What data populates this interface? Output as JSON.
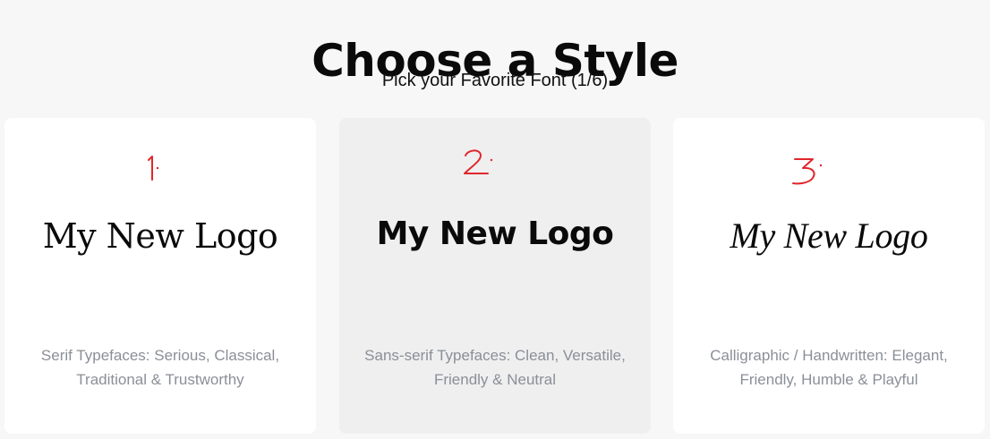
{
  "header": {
    "title": "Choose a Style",
    "subtitle": "Pick your Favorite Font (1/6)"
  },
  "cards": [
    {
      "number": "1.",
      "logo_text": "My New Logo",
      "description": "Serif Typefaces: Serious, Classical, Traditional & Trustworthy",
      "selected": false
    },
    {
      "number": "2.",
      "logo_text": "My New Logo",
      "description": "Sans-serif Typefaces: Clean, Versatile, Friendly & Neutral",
      "selected": true
    },
    {
      "number": "3.",
      "logo_text": "My New Logo",
      "description": "Calligraphic / Handwritten: Elegant, Friendly, Humble & Playful",
      "selected": false
    }
  ],
  "colors": {
    "background": "#f7f7f7",
    "card": "#ffffff",
    "card_highlight": "#efefef",
    "annotation": "#e0262b",
    "description_text": "#8a8f98"
  }
}
